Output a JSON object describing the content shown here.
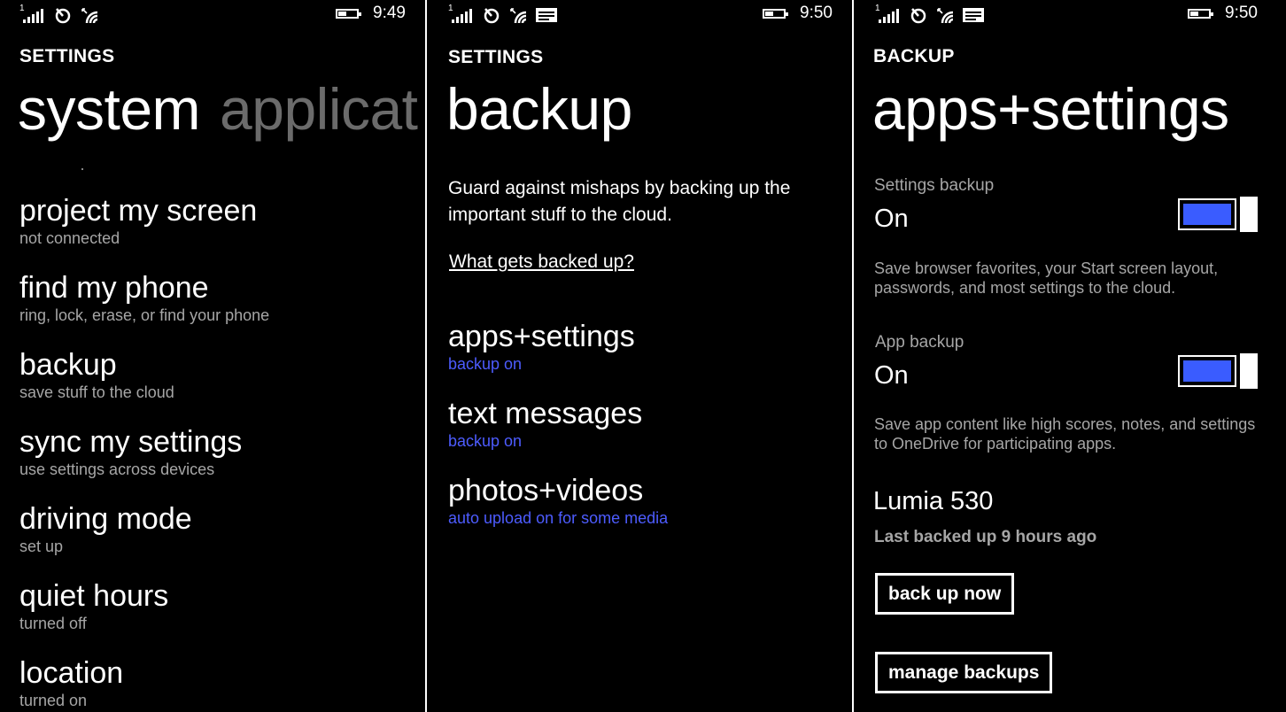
{
  "screen1": {
    "status": {
      "time": "9:49",
      "signal_digit": "1"
    },
    "title": "SETTINGS",
    "pivot_active": "system",
    "pivot_next": "applicat",
    "items": [
      {
        "title": "project my screen",
        "subtitle": "not connected"
      },
      {
        "title": "find my phone",
        "subtitle": "ring, lock, erase, or find your phone"
      },
      {
        "title": "backup",
        "subtitle": "save stuff to the cloud"
      },
      {
        "title": "sync my settings",
        "subtitle": "use settings across devices"
      },
      {
        "title": "driving mode",
        "subtitle": "set up"
      },
      {
        "title": "quiet hours",
        "subtitle": "turned off"
      },
      {
        "title": "location",
        "subtitle": "turned on"
      }
    ]
  },
  "screen2": {
    "status": {
      "time": "9:50",
      "signal_digit": "1"
    },
    "title": "SETTINGS",
    "heading": "backup",
    "description": "Guard against mishaps by backing up the important stuff to the cloud.",
    "link": "What gets backed up?",
    "items": [
      {
        "title": "apps+settings",
        "subtitle": "backup on"
      },
      {
        "title": "text messages",
        "subtitle": "backup on"
      },
      {
        "title": "photos+videos",
        "subtitle": "auto upload on for some media"
      }
    ]
  },
  "screen3": {
    "status": {
      "time": "9:50",
      "signal_digit": "1"
    },
    "title": "BACKUP",
    "heading": "apps+settings",
    "settings_backup": {
      "label": "Settings backup",
      "value": "On",
      "note": "Save browser favorites, your Start screen layout, passwords, and most settings to the cloud."
    },
    "app_backup": {
      "label": "App backup",
      "value": "On",
      "note": "Save app content like high scores, notes, and settings to OneDrive for participating apps."
    },
    "device_name": "Lumia 530",
    "last_backup": "Last backed up 9 hours ago",
    "back_up_now": "back up now",
    "manage_backups": "manage backups"
  },
  "colors": {
    "accent": "#3a5cff",
    "background": "#000000",
    "secondary_text": "#a6a6a6"
  },
  "icons": [
    "signal-icon",
    "data-sense-icon",
    "wifi-icon",
    "message-icon",
    "battery-icon"
  ]
}
